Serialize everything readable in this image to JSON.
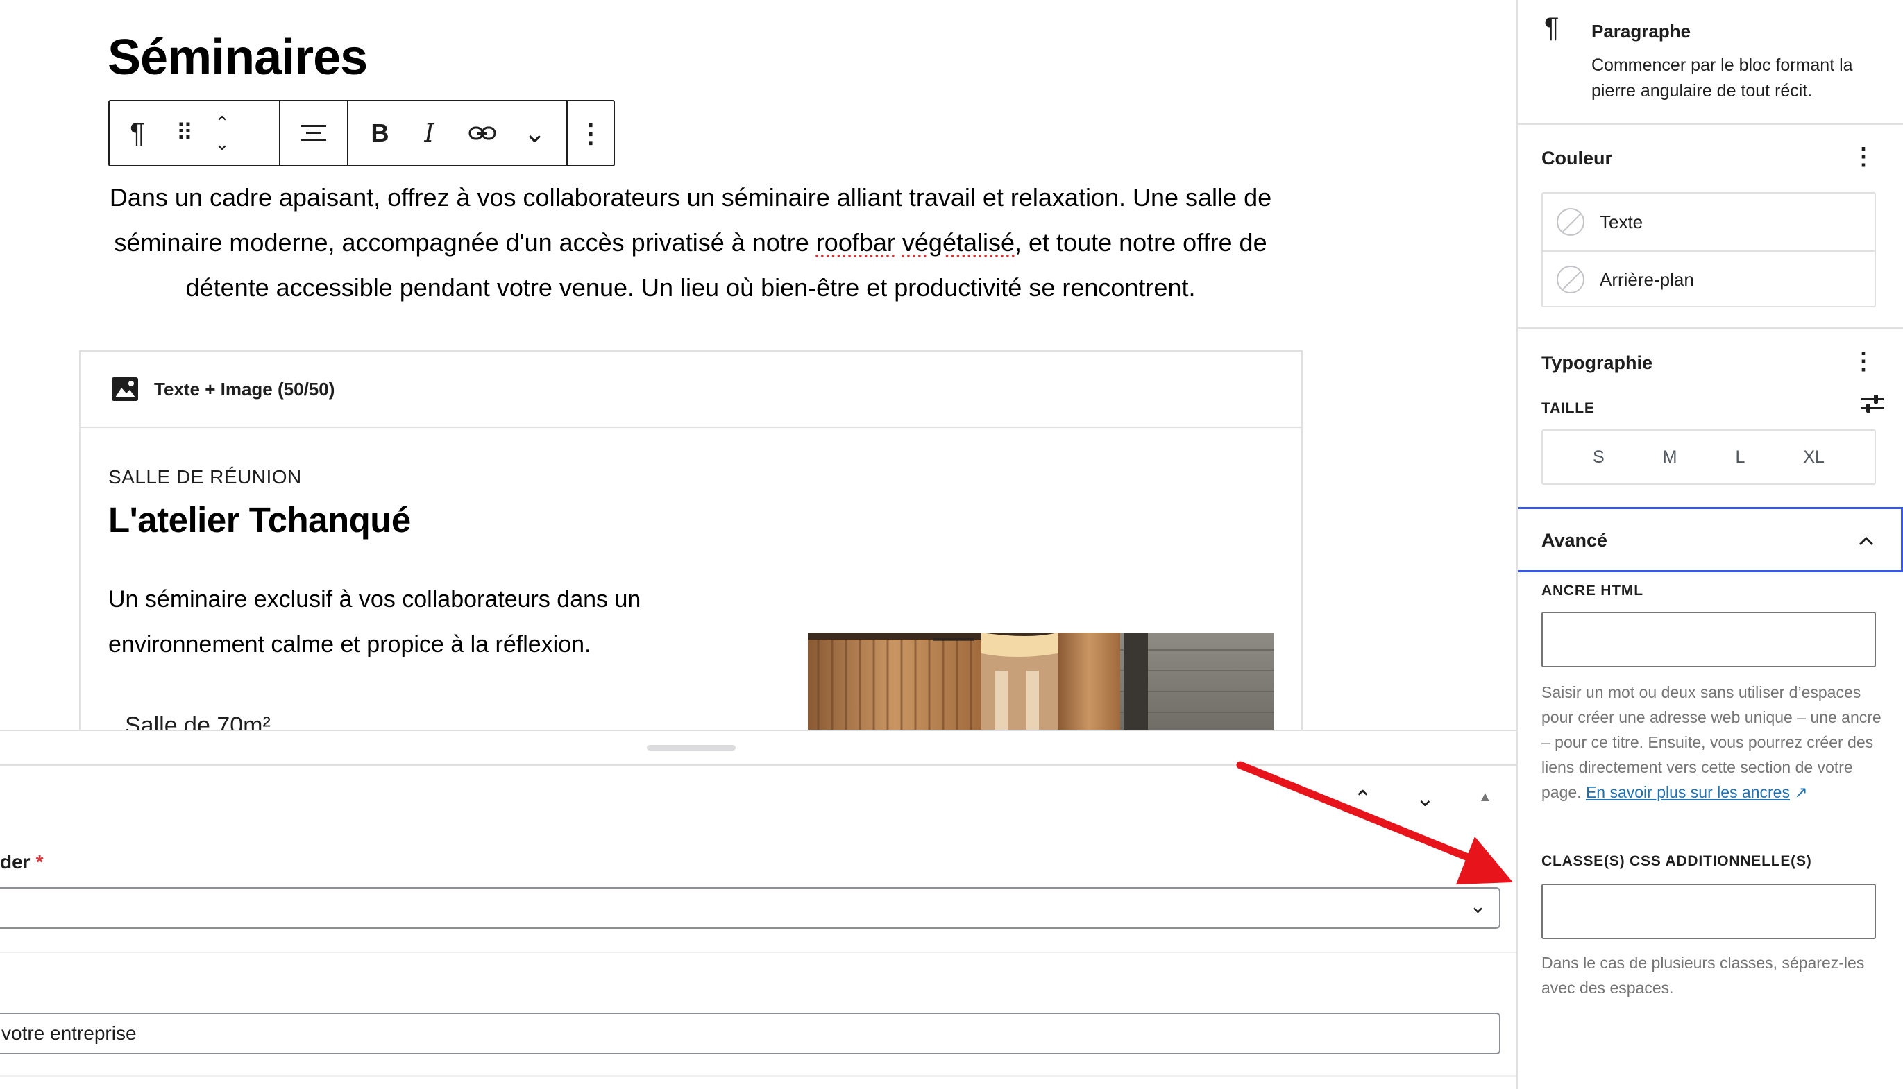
{
  "editor": {
    "page_title": "Séminaires",
    "toolbar": {
      "paragraph_icon": "¶",
      "drag_icon": "⠿",
      "move_up": "⌃",
      "move_down": "⌄",
      "align_icon": "≡",
      "bold": "B",
      "italic": "I",
      "link_icon": "⛓",
      "more_rich": "⌄",
      "options": "⋮"
    },
    "intro_line1": "Dans un cadre apaisant, offrez à vos collaborateurs un séminaire alliant travail et relaxation. Une salle de",
    "intro_line2_a": "séminaire moderne, accompagnée d'un accès privatisé à notre ",
    "intro_line2_b": "roofbar",
    "intro_line2_c": " ",
    "intro_line2_d": "végétalisé",
    "intro_line2_e": ", et toute notre offre de",
    "intro_line3": "détente accessible pendant votre venue. Un lieu où bien-être et productivité se rencontrent.",
    "tile_block": {
      "header": "Texte + Image (50/50)",
      "eyebrow": "SALLE DE RÉUNION",
      "title": "L'atelier Tchanqué",
      "body_line1": "Un séminaire exclusif à vos collaborateurs dans un",
      "body_line2": "environnement calme et propice à la réflexion.",
      "list_item": "Salle de 70m²"
    }
  },
  "metabox": {
    "field_label": "der",
    "required_mark": "*",
    "input_value": "votre entreprise",
    "up": "⌃",
    "down": "⌄",
    "toggle": "▲"
  },
  "sidebar": {
    "block_card": {
      "icon": "¶",
      "title": "Paragraphe",
      "description": "Commencer par le bloc formant la pierre angulaire de tout récit."
    },
    "color": {
      "title": "Couleur",
      "options_icon": "⋮",
      "items": [
        "Texte",
        "Arrière-plan"
      ]
    },
    "typography": {
      "title": "Typographie",
      "options_icon": "⋮",
      "size_label": "TAILLE",
      "sizes": [
        "S",
        "M",
        "L",
        "XL"
      ]
    },
    "advanced": {
      "title": "Avancé",
      "anchor_label": "ANCRE HTML",
      "anchor_help": "Saisir un mot ou deux sans utiliser d’espaces pour créer une adresse web unique – une ancre – pour ce titre. Ensuite, vous pourrez créer des liens directement vers cette section de votre page. ",
      "anchor_link": "En savoir plus sur les ancres",
      "anchor_link_icon": "↗",
      "css_label": "CLASSE(S) CSS ADDITIONNELLE(S)",
      "css_help": "Dans le cas de plusieurs classes, séparez-les avec des espaces."
    }
  },
  "colors": {
    "accent": "#3858e9",
    "annotation_arrow": "#e8141b",
    "required": "#d63638"
  }
}
